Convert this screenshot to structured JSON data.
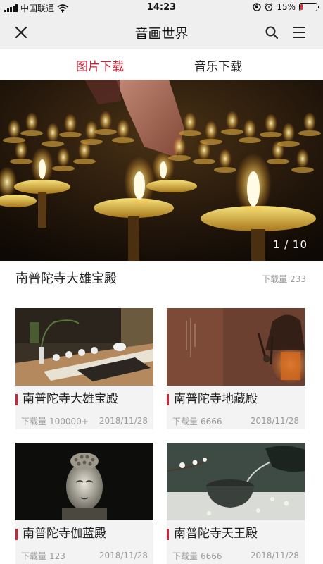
{
  "status_bar": {
    "carrier": "中国联通",
    "time": "14:23",
    "battery": "15%",
    "battery_level": 0.15,
    "icons": [
      "signal-icon",
      "wifi-icon",
      "orientation-lock-icon",
      "alarm-icon",
      "battery-icon"
    ]
  },
  "nav": {
    "title": "音画世界",
    "icons": [
      "close-icon",
      "search-icon",
      "menu-icon"
    ]
  },
  "tabs": [
    {
      "label": "图片下载",
      "active": true
    },
    {
      "label": "音乐下载",
      "active": false
    }
  ],
  "hero": {
    "counter": "1 / 10",
    "title": "南普陀寺大雄宝殿",
    "download_label": "下载量",
    "download_count": "233"
  },
  "cards": [
    {
      "title": "南普陀寺大雄宝殿",
      "download_label": "下载量",
      "download_count": "100000+",
      "date": "2018/11/28"
    },
    {
      "title": "南普陀寺地藏殿",
      "download_label": "下载量",
      "download_count": "6666",
      "date": "2018/11/28"
    },
    {
      "title": "南普陀寺伽蓝殿",
      "download_label": "下载量",
      "download_count": "123",
      "date": "2018/11/28"
    },
    {
      "title": "南普陀寺天王殿",
      "download_label": "下载量",
      "download_count": "6666",
      "date": "2018/11/28"
    }
  ],
  "colors": {
    "accent": "#c8273a",
    "bar_bg": "#efefef",
    "card_bg": "#f3f3f3",
    "muted": "#9a9a9a"
  }
}
